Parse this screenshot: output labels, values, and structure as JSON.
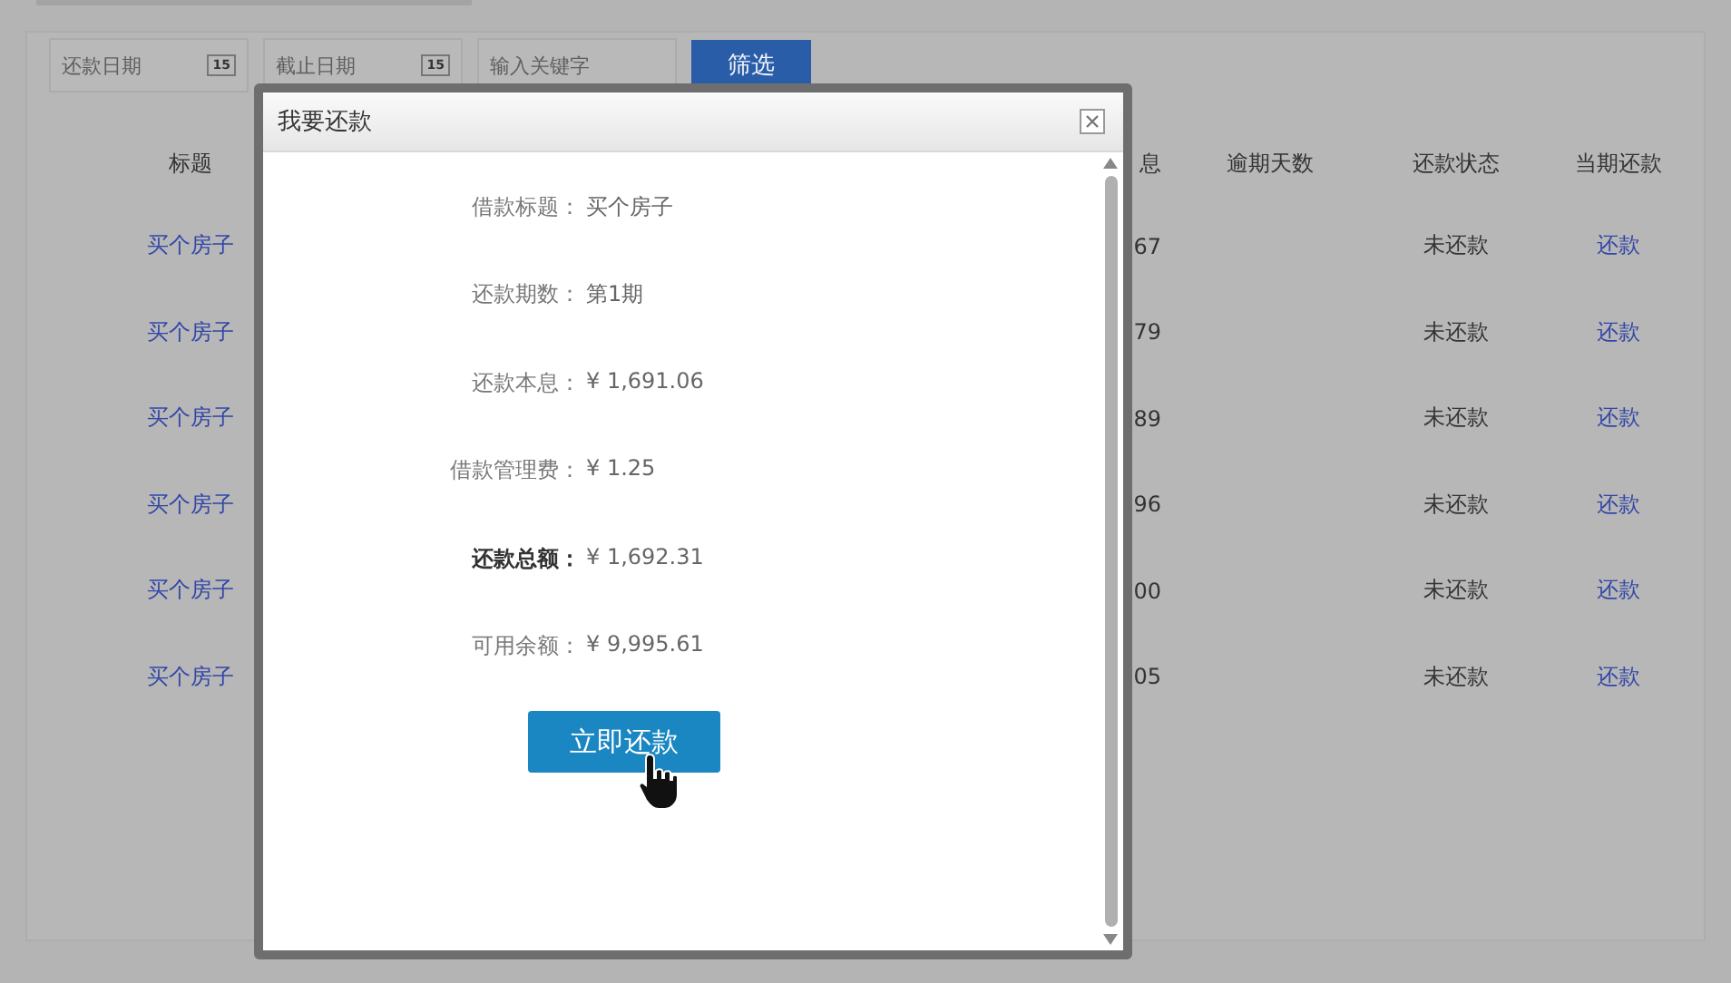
{
  "filters": [
    {
      "placeholder": "还款日期",
      "day": "15"
    },
    {
      "placeholder": "截止日期",
      "day": "15"
    },
    {
      "placeholder": "输入关键字"
    }
  ],
  "filter_button": "筛选",
  "table": {
    "columns": [
      "标题",
      "息",
      "逾期天数",
      "还款状态",
      "当期还款"
    ],
    "rows": [
      {
        "title": "买个房子",
        "interest": "67",
        "overdue": "",
        "status": "未还款",
        "action": "还款"
      },
      {
        "title": "买个房子",
        "interest": "79",
        "overdue": "",
        "status": "未还款",
        "action": "还款"
      },
      {
        "title": "买个房子",
        "interest": "89",
        "overdue": "",
        "status": "未还款",
        "action": "还款"
      },
      {
        "title": "买个房子",
        "interest": "96",
        "overdue": "",
        "status": "未还款",
        "action": "还款"
      },
      {
        "title": "买个房子",
        "interest": "00",
        "overdue": "",
        "status": "未还款",
        "action": "还款"
      },
      {
        "title": "买个房子",
        "interest": "05",
        "overdue": "",
        "status": "未还款",
        "action": "还款"
      }
    ]
  },
  "dialog": {
    "title": "我要还款",
    "fields": [
      {
        "label": "借款标题：",
        "value": "买个房子",
        "bold": false
      },
      {
        "label": "还款期数：",
        "value": "第1期",
        "bold": false
      },
      {
        "label": "还款本息：",
        "value": "¥ 1,691.06",
        "bold": false
      },
      {
        "label": "借款管理费：",
        "value": "¥ 1.25",
        "bold": false
      },
      {
        "label": "还款总额：",
        "value": "¥ 1,692.31",
        "bold": true
      },
      {
        "label": "可用余额：",
        "value": "¥ 9,995.61",
        "bold": false
      }
    ],
    "button": "立即还款"
  }
}
